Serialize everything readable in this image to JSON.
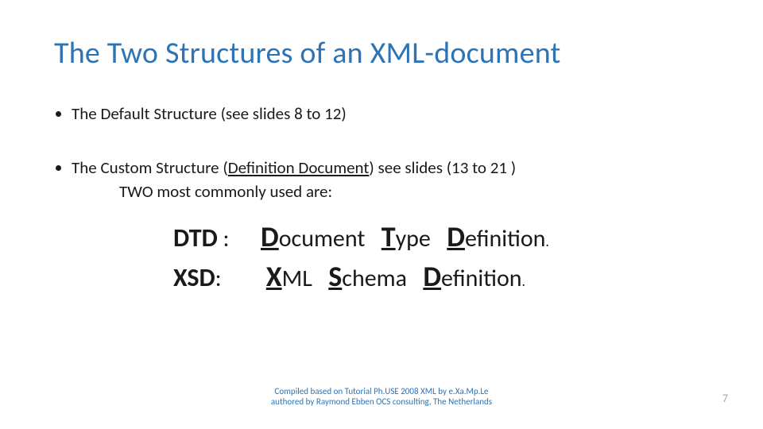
{
  "title": "The Two Structures of an XML-document",
  "bullet1": "The Default Structure (see slides 8 to 12)",
  "bullet2_pre": "The Custom Structure (",
  "bullet2_ud": "Definition Document",
  "bullet2_post": ") see slides (13 to 21 )",
  "bullet2_sub": "TWO most commonly used are:",
  "dtd": {
    "acr": "DTD",
    "colon": " :",
    "D": "D",
    "ocument": "ocument ",
    "T": "T",
    "ype": "ype ",
    "D2": "D",
    "efinition": "efinition",
    "dot": "."
  },
  "xsd": {
    "acr": "XSD",
    "colon": ":",
    "X": "X",
    "ml": "ML ",
    "S": "S",
    "chema": "chema ",
    "D": "D",
    "efinition": "efinition",
    "dot": "."
  },
  "footer1": "Compiled based on Tutorial Ph.USE 2008 XML by e.Xa.Mp.Le",
  "footer2": "authored by Raymond Ebben OCS consulting, The Netherlands",
  "pagenum": "7"
}
